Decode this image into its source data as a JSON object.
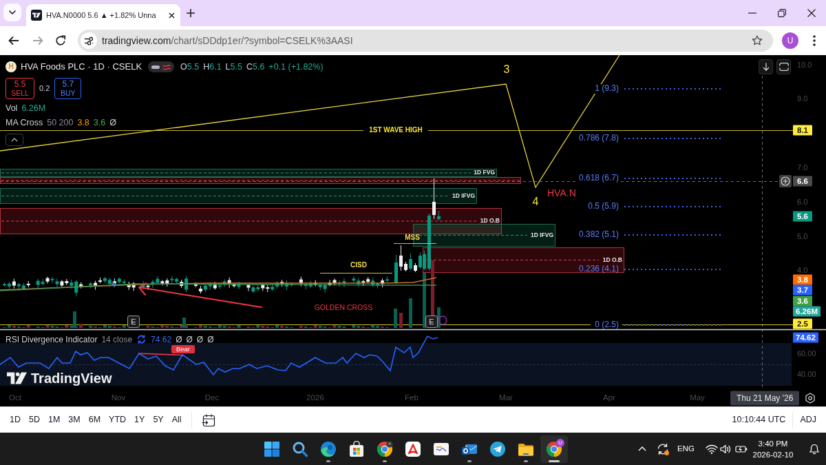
{
  "browser": {
    "tabs": [
      {
        "title": "HVA.N0000 5.6 ▲ +1.82% Unna",
        "selected": true
      }
    ],
    "url": {
      "host": "tradingview.com",
      "path": "/chart/sDDdp1er/?symbol=CSELK%3AASI"
    },
    "profile": "U"
  },
  "chart": {
    "symbol": {
      "logo": "H",
      "title": "HVA Foods PLC · 1D · CSELK",
      "ohlc": [
        {
          "label": "O",
          "value": "5.5"
        },
        {
          "label": "H",
          "value": "6.1"
        },
        {
          "label": "L",
          "value": "5.5"
        },
        {
          "label": "C",
          "value": "5.6"
        }
      ],
      "change": "+0.1 (+1.82%)"
    },
    "trade": {
      "sell": {
        "price": "5.5",
        "label": "SELL"
      },
      "spread": "0.2",
      "buy": {
        "price": "5.7",
        "label": "BUY"
      }
    },
    "indicators": [
      {
        "name": "Vol",
        "values": [
          {
            "text": "6.26M",
            "color": "#22ab94"
          }
        ]
      },
      {
        "name": "MA Cross",
        "params": "50 200",
        "values": [
          {
            "text": "3.8",
            "color": "#ff9800"
          },
          {
            "text": "3.6",
            "color": "#4caf50"
          },
          {
            "text": "Ø",
            "color": "#d1d4dc"
          }
        ]
      }
    ],
    "wave_labels": [
      "3",
      "4"
    ],
    "symbol_tag": "HVA.N",
    "wave_high": "1ST WAVE HIGH",
    "fib_levels": [
      "1 (9.3)",
      "0.786 (7.8)",
      "0.618 (6.7)",
      "0.5 (5.9)",
      "0.382 (5.1)",
      "0.236 (4.1)",
      "0 (2.5)"
    ],
    "zones": [
      {
        "kind": "fvg",
        "label": "1D FVG"
      },
      {
        "kind": "order_block"
      },
      {
        "kind": "fvg",
        "label": "1D IFVG"
      },
      {
        "kind": "order_block",
        "label": "1D O.B"
      },
      {
        "kind": "fvg",
        "label": "1D IFVG"
      },
      {
        "kind": "order_block",
        "label": "1D O.B"
      }
    ],
    "notes": [
      {
        "kind": "structure",
        "text": "MSS"
      },
      {
        "kind": "structure",
        "text": "CISD"
      },
      {
        "kind": "signal",
        "text": "GOLDEN CROSS"
      }
    ],
    "events": [
      "E",
      "E"
    ],
    "price_ticks": [
      "10.0",
      "9.0",
      "7.0",
      "6.0",
      "5.0",
      "4.0"
    ],
    "price_labels": [
      {
        "text": "8.1",
        "color": "#ffeb3b"
      },
      {
        "text": "6.6",
        "color": "#4a4a4a"
      },
      {
        "text": "5.6",
        "color": "#089981"
      },
      {
        "text": "3.8",
        "color": "#ff6d00"
      },
      {
        "text": "3.7",
        "color": "#2962ff"
      },
      {
        "text": "3.6",
        "color": "#43a047"
      },
      {
        "text": "6.26M",
        "color": "#26a69a"
      },
      {
        "text": "2.5",
        "color": "#ffeb3b"
      }
    ],
    "time_ticks": [
      "Oct",
      "Nov",
      "Dec",
      "2026",
      "Feb",
      "Mar",
      "Apr",
      "May"
    ],
    "crosshair_date": "Thu 21 May '26",
    "rsi": {
      "name": "RSI Divergence Indicator",
      "params": "14 close",
      "value": "74.62",
      "extras": [
        "Ø",
        "Ø",
        "Ø",
        "Ø"
      ],
      "signal": "Bear",
      "ticks": [
        "60.00",
        "40.00"
      ],
      "label": "74.62"
    },
    "brand": "TradingView"
  },
  "range_bar": {
    "ranges": [
      {
        "label": "1D",
        "selected": false
      },
      {
        "label": "5D",
        "selected": false
      },
      {
        "label": "1M",
        "selected": false
      },
      {
        "label": "3M",
        "selected": false
      },
      {
        "label": "6M",
        "selected": false
      },
      {
        "label": "YTD",
        "selected": false
      },
      {
        "label": "1Y",
        "selected": false
      },
      {
        "label": "5Y",
        "selected": false
      },
      {
        "label": "All",
        "selected": false
      }
    ],
    "clock": "10:10:44 UTC",
    "adjust": "ADJ"
  },
  "taskbar": {
    "apps": [
      {
        "kind": "start",
        "running": false,
        "selected": false,
        "avatar_badge": false
      },
      {
        "kind": "search",
        "running": false,
        "selected": false,
        "avatar_badge": false
      },
      {
        "kind": "edge",
        "running": true,
        "selected": false,
        "avatar_badge": false
      },
      {
        "kind": "store",
        "running": false,
        "selected": false,
        "avatar_badge": false
      },
      {
        "kind": "chrome",
        "running": true,
        "selected": false,
        "avatar_badge": true
      },
      {
        "kind": "reader",
        "running": false,
        "selected": false,
        "avatar_badge": false
      },
      {
        "kind": "tile",
        "running": false,
        "selected": false,
        "avatar_badge": false
      },
      {
        "kind": "mail",
        "running": true,
        "selected": false,
        "avatar_badge": false
      },
      {
        "kind": "messenger",
        "running": false,
        "selected": false,
        "avatar_badge": false
      },
      {
        "kind": "folder",
        "running": true,
        "selected": false,
        "avatar_badge": false
      },
      {
        "kind": "chrome",
        "running": true,
        "selected": true,
        "avatar_badge": false,
        "badge": "U"
      }
    ],
    "language": "ENG",
    "time": "3:40 PM",
    "date": "2026-02-10"
  }
}
